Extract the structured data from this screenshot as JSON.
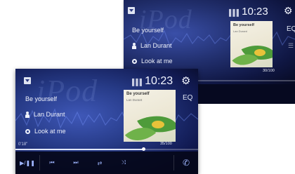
{
  "back_screen": {
    "clock": "10:23",
    "signal": "▌▌▌",
    "source_logo": "iPod",
    "song_title": "Be yourself",
    "artist": "Lan Durant",
    "album": "Look at me",
    "album_art": {
      "title": "Be yourself",
      "subtitle": "Lan Durant"
    },
    "track_percent": "30/100",
    "eq_label": "EQ",
    "progress": 0.25
  },
  "front_screen": {
    "clock": "10:23",
    "signal": "▌▌▌",
    "source_logo": "iPod",
    "song_title": "Be yourself",
    "artist": "Lan Durant",
    "album": "Look at me",
    "album_art": {
      "title": "Be yourself",
      "subtitle": "Lan Durant"
    },
    "elapsed": "0'18\"",
    "track_percent": "35/100",
    "eq_label": "EQ",
    "progress": 0.7,
    "controls": {
      "play_pause": "▶/❚❚",
      "prev": "⏮",
      "next": "⏭",
      "repeat": "⇄",
      "shuffle": "⤨",
      "phone": "✆"
    }
  }
}
